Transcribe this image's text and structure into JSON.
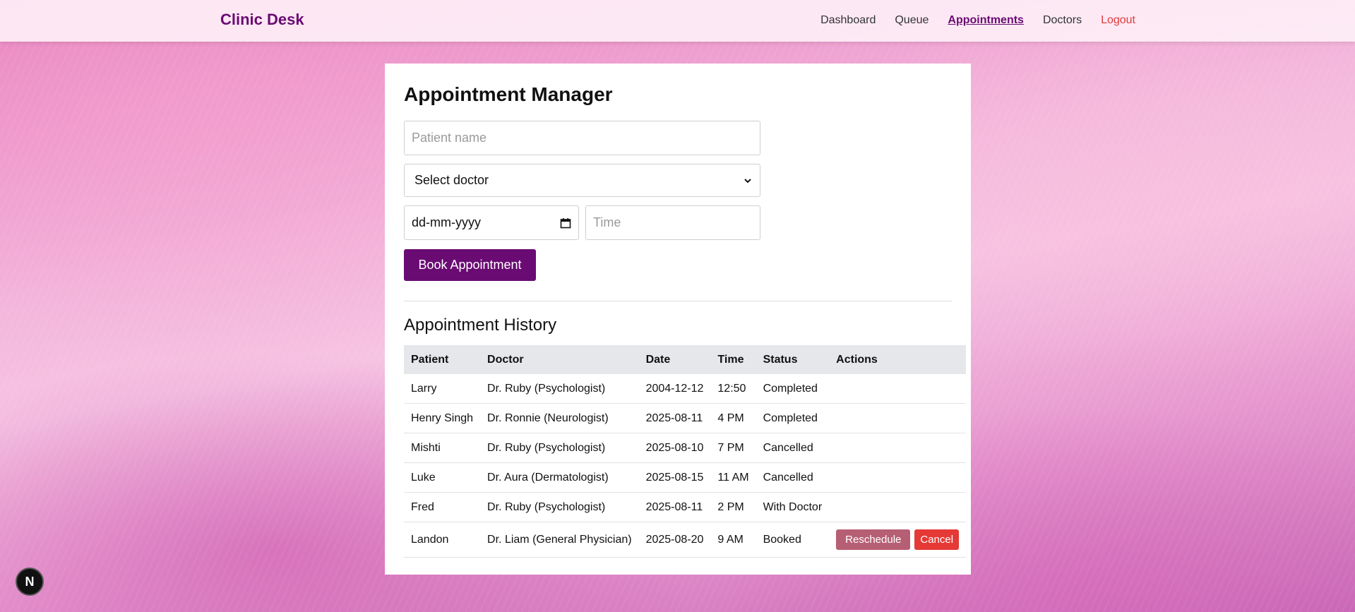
{
  "brand": "Clinic Desk",
  "nav": {
    "dashboard": "Dashboard",
    "queue": "Queue",
    "appointments": "Appointments",
    "doctors": "Doctors",
    "logout": "Logout"
  },
  "form": {
    "title": "Appointment Manager",
    "patient_placeholder": "Patient name",
    "doctor_select": "Select doctor",
    "date_placeholder": "dd-mm-yyyy",
    "time_placeholder": "Time",
    "book_label": "Book Appointment"
  },
  "history": {
    "title": "Appointment History",
    "columns": [
      "Patient",
      "Doctor",
      "Date",
      "Time",
      "Status",
      "Actions"
    ],
    "rows": [
      {
        "patient": "Larry",
        "doctor": "Dr. Ruby (Psychologist)",
        "date": "2004-12-12",
        "time": "12:50",
        "status": "Completed"
      },
      {
        "patient": "Henry Singh",
        "doctor": "Dr. Ronnie (Neurologist)",
        "date": "2025-08-11",
        "time": "4 PM",
        "status": "Completed"
      },
      {
        "patient": "Mishti",
        "doctor": "Dr. Ruby (Psychologist)",
        "date": "2025-08-10",
        "time": "7 PM",
        "status": "Cancelled"
      },
      {
        "patient": "Luke",
        "doctor": "Dr. Aura (Dermatologist)",
        "date": "2025-08-15",
        "time": "11 AM",
        "status": "Cancelled"
      },
      {
        "patient": "Fred",
        "doctor": "Dr. Ruby (Psychologist)",
        "date": "2025-08-11",
        "time": "2 PM",
        "status": "With Doctor"
      },
      {
        "patient": "Landon",
        "doctor": "Dr. Liam (General Physician)",
        "date": "2025-08-20",
        "time": "9 AM",
        "status": "Booked",
        "actions": {
          "reschedule": "Reschedule",
          "cancel": "Cancel"
        }
      }
    ]
  },
  "badge": "N",
  "colors": {
    "brand": "#6a0b73",
    "logout": "#e03b3b",
    "reschedule": "#b65f74",
    "cancel": "#e53935"
  }
}
